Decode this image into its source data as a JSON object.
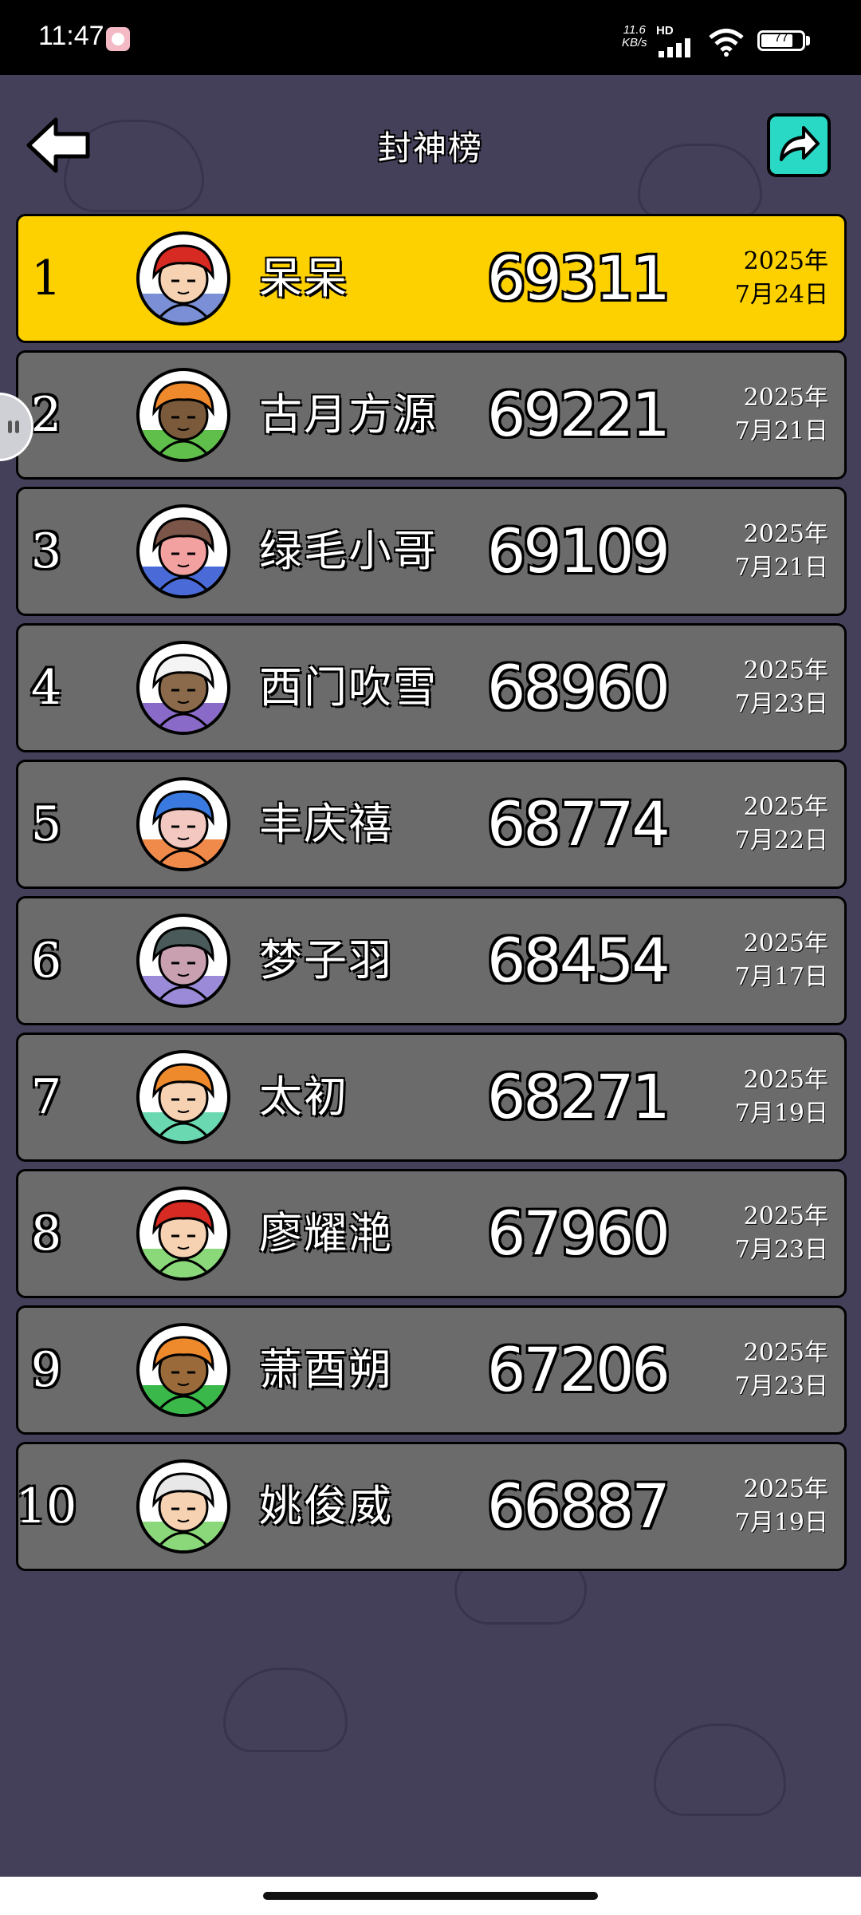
{
  "status_bar": {
    "time": "11:47",
    "net_speed_value": "11.6",
    "net_speed_unit": "KB/s",
    "network_label": "HD",
    "battery": "77"
  },
  "header": {
    "title": "封神榜",
    "back_icon": "arrow-left-icon",
    "share_icon": "share-arrow-icon",
    "share_color": "#29d9c6"
  },
  "colors": {
    "background": "#45405a",
    "row": "#6c6b6c",
    "first_row": "#fdd000"
  },
  "leaderboard": [
    {
      "rank": "1",
      "name": "呆呆",
      "score": "69311",
      "date_year": "2025年",
      "date_day": "7月24日",
      "avatar": {
        "hair": "#d62a22",
        "body": "#7a8fd6",
        "skin": "#f6d2b3"
      }
    },
    {
      "rank": "2",
      "name": "古月方源",
      "score": "69221",
      "date_year": "2025年",
      "date_day": "7月21日",
      "avatar": {
        "hair": "#ef8a2c",
        "body": "#5fbf4a",
        "skin": "#7a5a3a"
      }
    },
    {
      "rank": "3",
      "name": "绿毛小哥",
      "score": "69109",
      "date_year": "2025年",
      "date_day": "7月21日",
      "avatar": {
        "hair": "#7a5548",
        "body": "#4a6ad8",
        "skin": "#f2a0a0"
      }
    },
    {
      "rank": "4",
      "name": "西门吹雪",
      "score": "68960",
      "date_year": "2025年",
      "date_day": "7月23日",
      "avatar": {
        "hair": "#f4f4f4",
        "body": "#8a6ac8",
        "skin": "#8a6a4a"
      }
    },
    {
      "rank": "5",
      "name": "丰庆禧",
      "score": "68774",
      "date_year": "2025年",
      "date_day": "7月22日",
      "avatar": {
        "hair": "#3a7ae0",
        "body": "#f08a4a",
        "skin": "#f2c8c0"
      }
    },
    {
      "rank": "6",
      "name": "梦子羽",
      "score": "68454",
      "date_year": "2025年",
      "date_day": "7月17日",
      "avatar": {
        "hair": "#4a5a5a",
        "body": "#9a8ad8",
        "skin": "#c8a0b0"
      }
    },
    {
      "rank": "7",
      "name": "太初",
      "score": "68271",
      "date_year": "2025年",
      "date_day": "7月19日",
      "avatar": {
        "hair": "#ef8a2c",
        "body": "#6ad8b0",
        "skin": "#f6d2b3"
      }
    },
    {
      "rank": "8",
      "name": "廖耀滟",
      "score": "67960",
      "date_year": "2025年",
      "date_day": "7月23日",
      "avatar": {
        "hair": "#d62a22",
        "body": "#8ad87a",
        "skin": "#f6d2b3"
      }
    },
    {
      "rank": "9",
      "name": "萧酉朔",
      "score": "67206",
      "date_year": "2025年",
      "date_day": "7月23日",
      "avatar": {
        "hair": "#ef8a2c",
        "body": "#3ab84a",
        "skin": "#9a6a3a"
      }
    },
    {
      "rank": "10",
      "name": "姚俊威",
      "score": "66887",
      "date_year": "2025年",
      "date_day": "7月19日",
      "avatar": {
        "hair": "#e8e8e8",
        "body": "#8ad87a",
        "skin": "#f6d2b3"
      }
    }
  ]
}
